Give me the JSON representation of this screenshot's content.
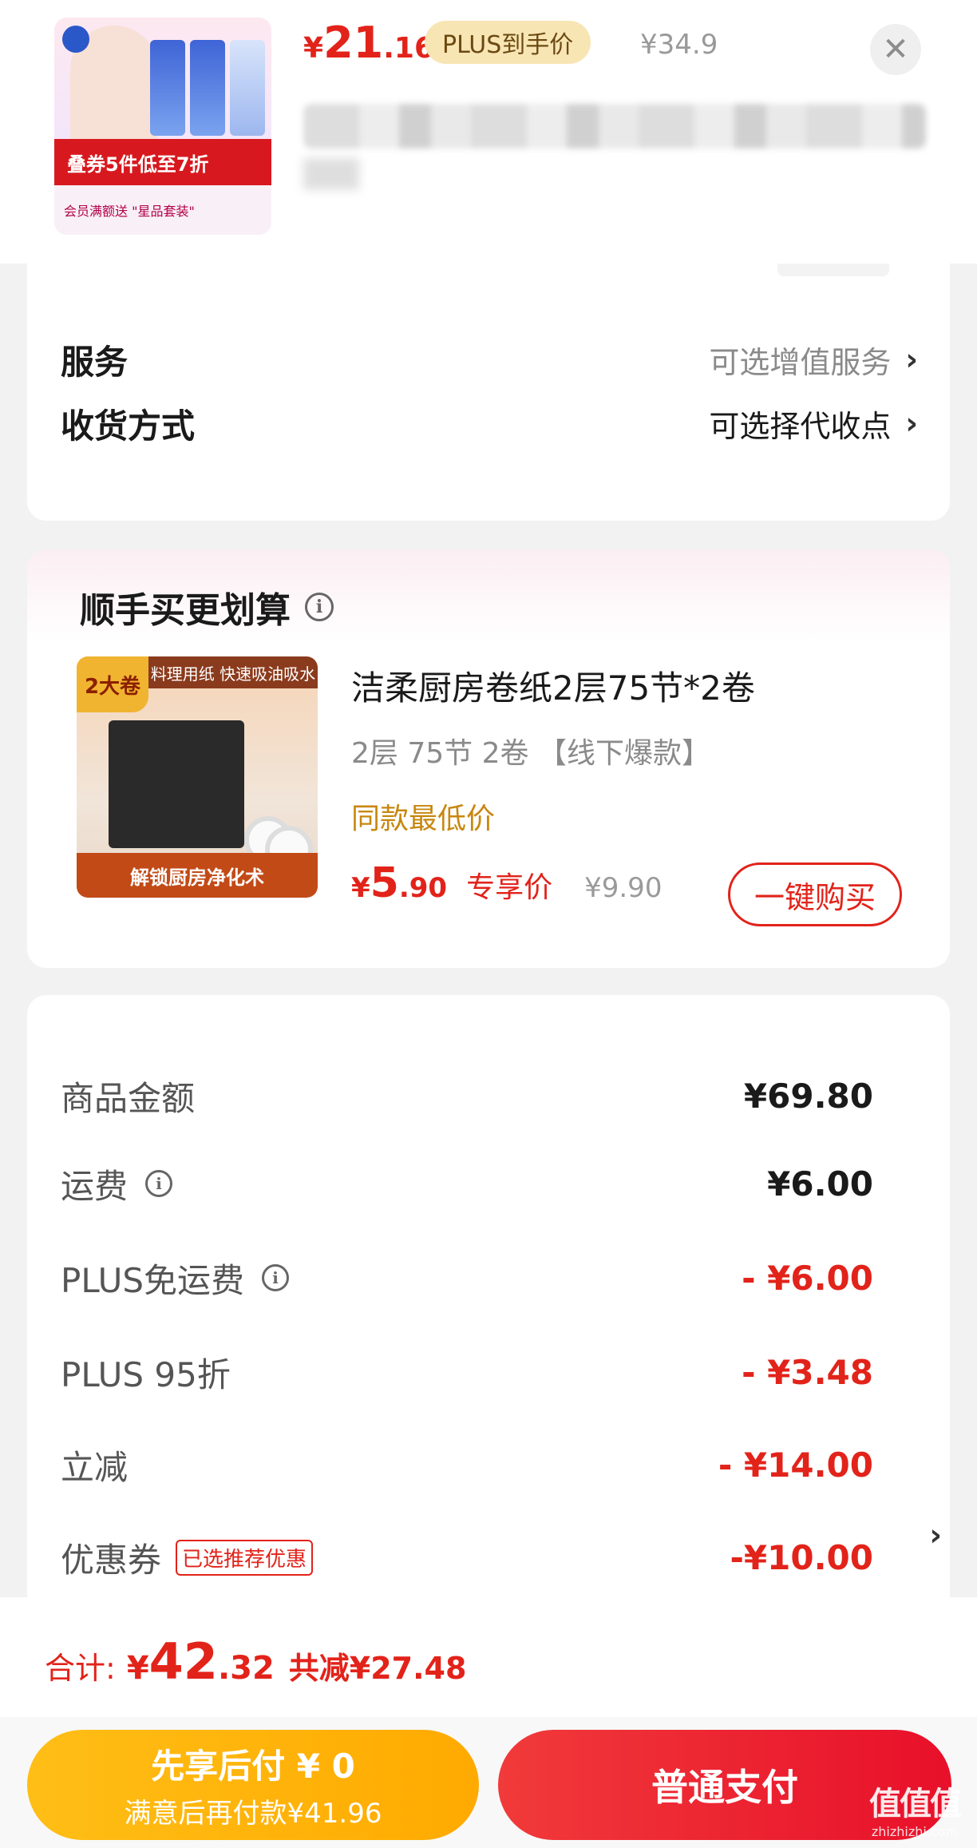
{
  "header": {
    "price_yen": "¥",
    "price_int": "21",
    "price_dec": ".16",
    "plus_badge": "PLUS到手价",
    "original_price": "¥34.9",
    "close_icon": "close-icon",
    "thumbnail": {
      "tag_text": "叠券5件低至7折",
      "bottom_text": "会员满额送 \"星品套装\""
    }
  },
  "service": {
    "rows": [
      {
        "label": "服务",
        "value": "可选增值服务"
      },
      {
        "label": "收货方式",
        "value": "可选择代收点"
      }
    ]
  },
  "upsell": {
    "title": "顺手买更划算",
    "product": {
      "name": "洁柔厨房卷纸2层75节*2卷",
      "spec": "2层 75节 2卷 【线下爆款】",
      "tag": "同款最低价",
      "price_yen": "¥",
      "price_int": "5",
      "price_dec": ".90",
      "exclusive": "专享价",
      "original": "¥9.90",
      "buy_label": "一键购买",
      "image": {
        "corner": "2大卷",
        "top": "料理用纸 快速吸油吸水",
        "bottom": "解锁厨房净化术"
      }
    }
  },
  "summary": {
    "rows": [
      {
        "label": "商品金额",
        "value": "¥69.80"
      },
      {
        "label": "运费",
        "value": "¥6.00"
      },
      {
        "label": "PLUS免运费",
        "value": "- ¥6.00"
      },
      {
        "label": "PLUS 95折",
        "value": "- ¥3.48"
      },
      {
        "label": "立减",
        "value": "- ¥14.00"
      },
      {
        "label": "优惠券",
        "value": "-¥10.00",
        "tag": "已选推荐优惠"
      }
    ]
  },
  "total": {
    "label": "合计:",
    "yen": "¥",
    "int": "42",
    "dec": ".32",
    "saved": "共减¥27.48"
  },
  "actions": {
    "pay_later_title": "先享后付 ¥ 0",
    "pay_later_sub": "满意后再付款¥41.96",
    "pay_normal": "普通支付"
  },
  "watermark": {
    "main": "值值值",
    "sub": "zhizhizhi.com"
  },
  "colors": {
    "accent_red": "#e2231a",
    "plus_gold": "#f8e5b4",
    "pay_later_yellow": "#ffb300"
  }
}
